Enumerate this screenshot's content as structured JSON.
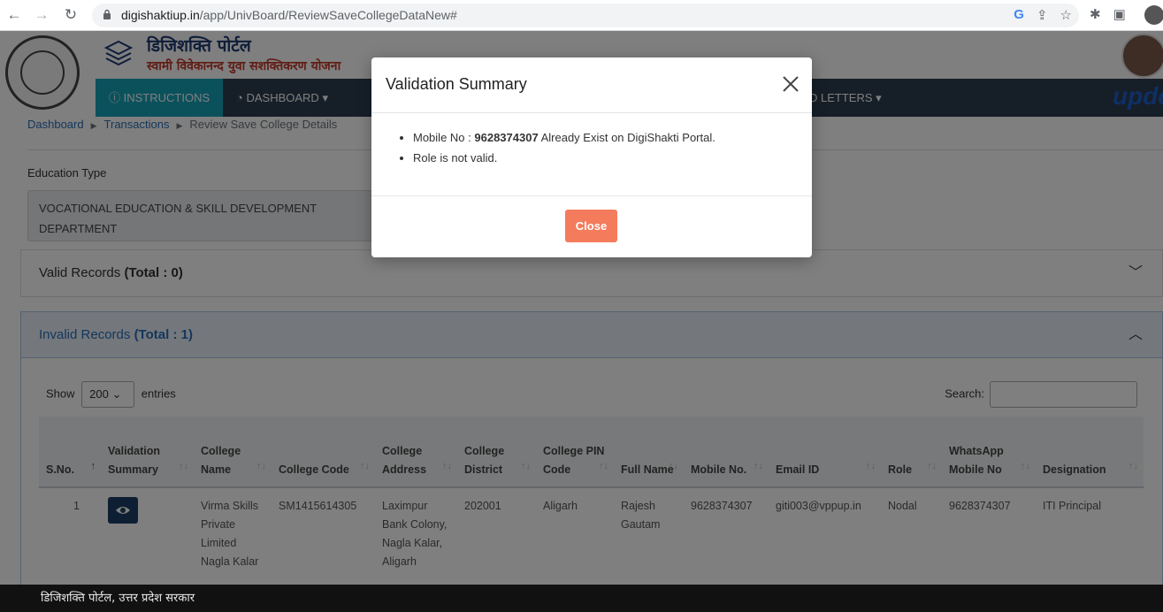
{
  "browser": {
    "url_domain": "digishaktiup.in",
    "url_path": "/app/UnivBoard/ReviewSaveCollegeDataNew#"
  },
  "header": {
    "title": "डिजिशक्ति पोर्टल",
    "subtitle": "स्वामी विवेकानन्द युवा सशक्तिकरण योजना",
    "brand": "upde"
  },
  "navbar": {
    "instructions": "INSTRUCTIONS",
    "dashboard": "DASHBOARD",
    "letters": "D LETTERS"
  },
  "breadcrumb": {
    "item1": "Dashboard",
    "item2": "Transactions",
    "current": "Review Save College Details"
  },
  "education": {
    "label": "Education Type",
    "value": "VOCATIONAL EDUCATION & SKILL DEVELOPMENT DEPARTMENT"
  },
  "valid_panel": {
    "label": "Valid Records",
    "total": "(Total : 0)"
  },
  "invalid_panel": {
    "label": "Invalid Records",
    "total": "(Total : 1)",
    "show_label": "Show",
    "entries_count": "200",
    "entries_label": "entries",
    "search_label": "Search:"
  },
  "table": {
    "headers": [
      "S.No.",
      "Validation Summary",
      "College Name",
      "College Code",
      "College Address",
      "College District",
      "College PIN Code",
      "Full Name",
      "Mobile No.",
      "Email ID",
      "Role",
      "WhatsApp Mobile No",
      "Designation"
    ],
    "rows": [
      {
        "sno": "1",
        "college_name": "Virma Skills Private Limited Nagla Kalar",
        "college_code": "SM1415614305",
        "college_address": "Laximpur Bank Colony, Nagla Kalar, Aligarh",
        "college_district": "202001",
        "pin_code": "Aligarh",
        "full_name": "Rajesh Gautam",
        "mobile": "9628374307",
        "email": "giti003@vppup.in",
        "role": "Nodal",
        "whatsapp": "9628374307",
        "designation": "ITI Principal"
      }
    ]
  },
  "footer": {
    "text": "डिजिशक्ति पोर्टल, उत्तर प्रदेश सरकार"
  },
  "modal": {
    "title": "Validation Summary",
    "msg1_prefix": "Mobile No :",
    "msg1_number": "9628374307",
    "msg1_suffix": "Already Exist on DigiShakti Portal.",
    "msg2": "Role is not valid.",
    "close_label": "Close"
  },
  "colors": {
    "navbar": "#2c3e50",
    "accent": "#17a2b8",
    "close_button": "#f47b5c",
    "eye_button": "#1c3f66"
  }
}
